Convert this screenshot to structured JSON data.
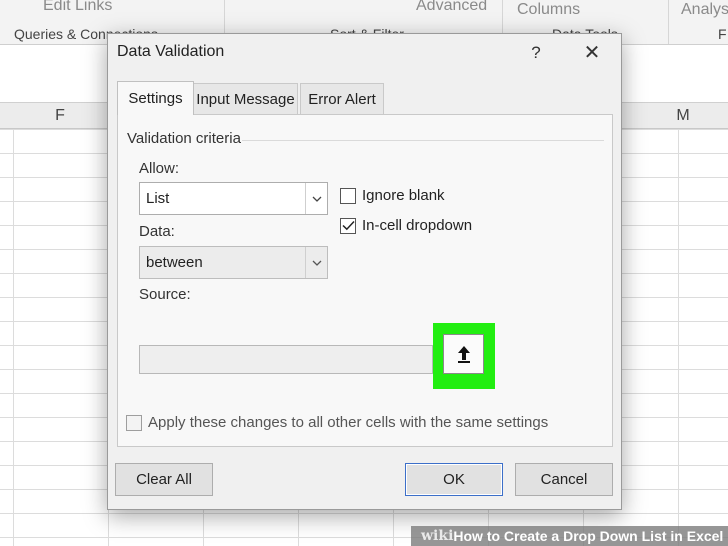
{
  "ribbon": {
    "items": [
      "Edit Links",
      "Advanced",
      "Columns",
      "Analysis"
    ],
    "groups": [
      "Queries & Connections",
      "Sort & Filter",
      "Data Tools",
      "F"
    ]
  },
  "sheet": {
    "columns": [
      "F",
      "M"
    ]
  },
  "dialog": {
    "title": "Data Validation",
    "help": "?",
    "close": "✕",
    "tabs": [
      "Settings",
      "Input Message",
      "Error Alert"
    ],
    "active_tab": "Settings",
    "section_label": "Validation criteria",
    "allow": {
      "label": "Allow:",
      "value": "List"
    },
    "data": {
      "label": "Data:",
      "value": "between"
    },
    "ignore_blank": {
      "label": "Ignore blank",
      "checked": false
    },
    "in_cell_dropdown": {
      "label": "In-cell dropdown",
      "checked": true
    },
    "source": {
      "label": "Source:",
      "value": ""
    },
    "apply_all": {
      "label": "Apply these changes to all other cells with the same settings",
      "checked": false
    },
    "buttons": {
      "clear_all": "Clear All",
      "ok": "OK",
      "cancel": "Cancel"
    },
    "highlight_color": "#22ee11"
  },
  "watermark": {
    "brand": "wiki",
    "title": "How to Create a Drop Down List in Excel"
  }
}
